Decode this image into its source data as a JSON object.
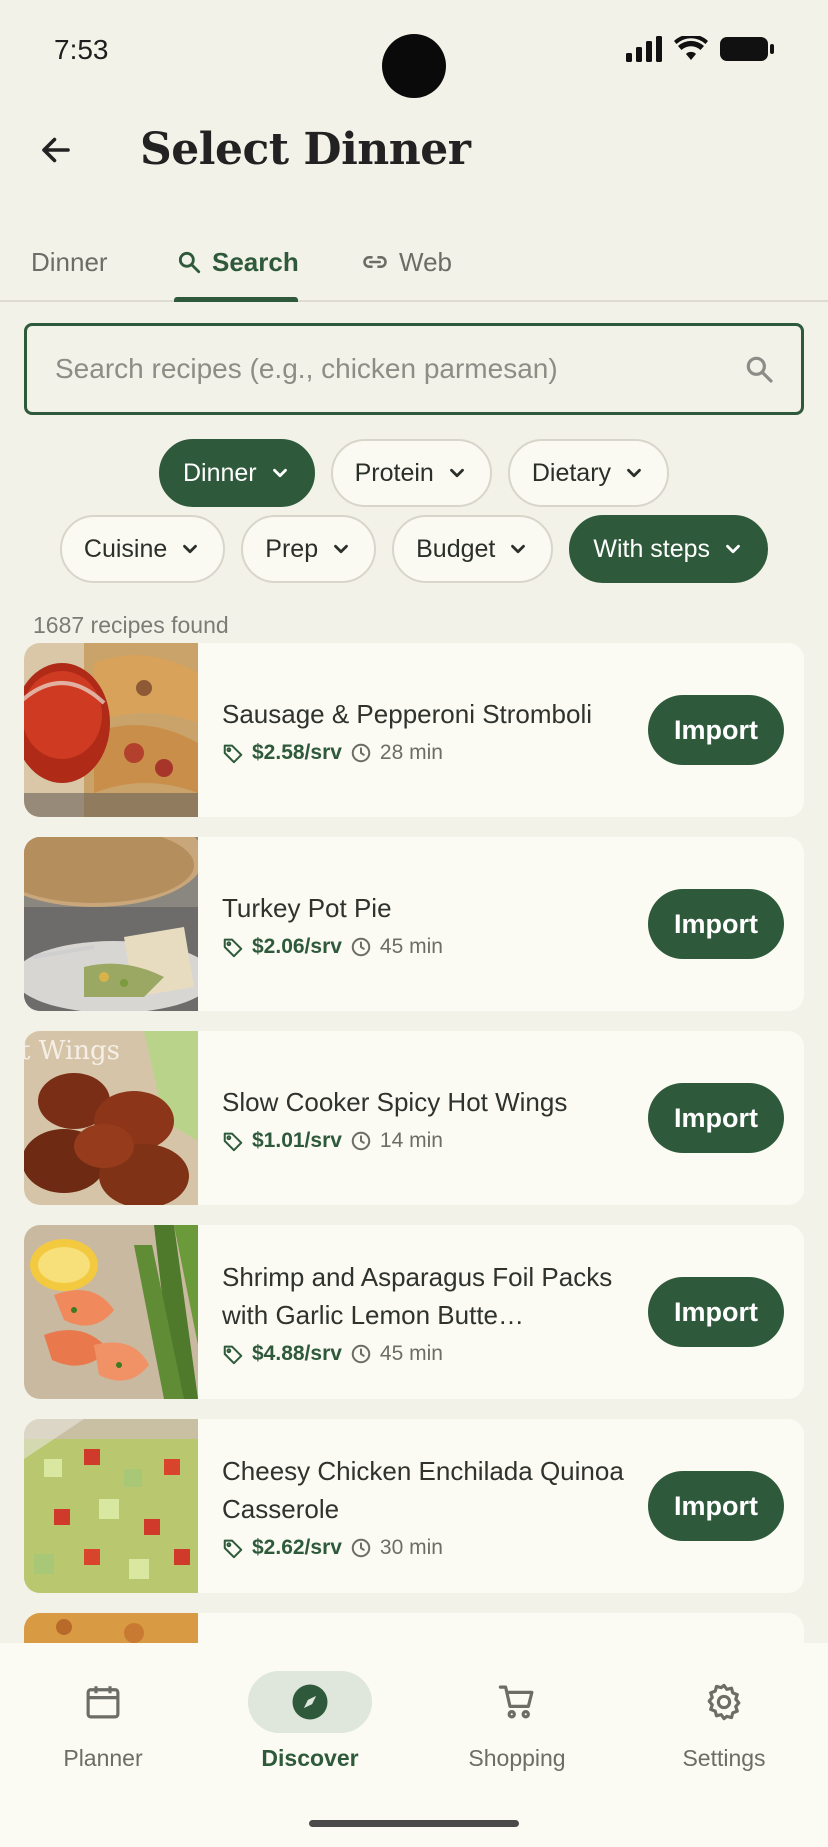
{
  "status_bar": {
    "time": "7:53"
  },
  "header": {
    "title": "Select Dinner"
  },
  "tabs": [
    {
      "label": "Dinner",
      "icon": "none",
      "active": false
    },
    {
      "label": "Search",
      "icon": "search-icon",
      "active": true
    },
    {
      "label": "Web",
      "icon": "link-icon",
      "active": false
    }
  ],
  "search": {
    "placeholder": "Search recipes (e.g., chicken parmesan)",
    "value": ""
  },
  "filters": {
    "row1": [
      {
        "label": "Dinner",
        "active": true
      },
      {
        "label": "Protein",
        "active": false
      },
      {
        "label": "Dietary",
        "active": false
      }
    ],
    "row2": [
      {
        "label": "Cuisine",
        "active": false
      },
      {
        "label": "Prep",
        "active": false
      },
      {
        "label": "Budget",
        "active": false
      },
      {
        "label": "With steps",
        "active": true
      }
    ]
  },
  "results": {
    "count_text": "1687 recipes found"
  },
  "recipes": [
    {
      "title": "Sausage & Pepperoni Stromboli",
      "price": "$2.58/srv",
      "time": "28 min",
      "button": "Import"
    },
    {
      "title": "Turkey Pot Pie",
      "price": "$2.06/srv",
      "time": "45 min",
      "button": "Import"
    },
    {
      "title": "Slow Cooker Spicy Hot Wings",
      "price": "$1.01/srv",
      "time": "14 min",
      "button": "Import",
      "thumb_caption": "t Wings"
    },
    {
      "title": "Shrimp and Asparagus Foil Packs with Garlic Lemon Butte…",
      "price": "$4.88/srv",
      "time": "45 min",
      "button": "Import"
    },
    {
      "title": "Cheesy Chicken Enchilada Quinoa Casserole",
      "price": "$2.62/srv",
      "time": "30 min",
      "button": "Import"
    }
  ],
  "bottom_nav": [
    {
      "label": "Planner",
      "icon": "calendar-icon",
      "active": false
    },
    {
      "label": "Discover",
      "icon": "compass-icon",
      "active": true
    },
    {
      "label": "Shopping",
      "icon": "cart-icon",
      "active": false
    },
    {
      "label": "Settings",
      "icon": "gear-icon",
      "active": false
    }
  ],
  "colors": {
    "accent": "#2e5a3b",
    "background": "#f3f2e8",
    "card": "#fbfaf3"
  }
}
